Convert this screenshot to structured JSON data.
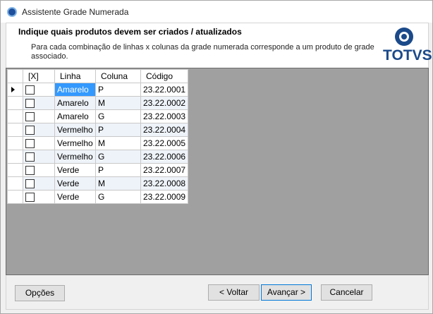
{
  "window": {
    "title": "Assistente Grade Numerada"
  },
  "header": {
    "title": "Indique quais produtos devem ser criados / atualizados",
    "description": "Para cada combinação de linhas x colunas da grade numerada corresponde a um produto de grade associado.",
    "logo_text": "TOTVS",
    "brand_color": "#1b4a8a"
  },
  "grid": {
    "columns": [
      "[X]",
      "Linha",
      "Coluna",
      "Código"
    ],
    "rows": [
      {
        "checked": false,
        "linha": "Amarelo",
        "coluna": "P",
        "codigo": "23.22.0001"
      },
      {
        "checked": false,
        "linha": "Amarelo",
        "coluna": "M",
        "codigo": "23.22.0002"
      },
      {
        "checked": false,
        "linha": "Amarelo",
        "coluna": "G",
        "codigo": "23.22.0003"
      },
      {
        "checked": false,
        "linha": "Vermelho",
        "coluna": "P",
        "codigo": "23.22.0004"
      },
      {
        "checked": false,
        "linha": "Vermelho",
        "coluna": "M",
        "codigo": "23.22.0005"
      },
      {
        "checked": false,
        "linha": "Vermelho",
        "coluna": "G",
        "codigo": "23.22.0006"
      },
      {
        "checked": false,
        "linha": "Verde",
        "coluna": "P",
        "codigo": "23.22.0007"
      },
      {
        "checked": false,
        "linha": "Verde",
        "coluna": "M",
        "codigo": "23.22.0008"
      },
      {
        "checked": false,
        "linha": "Verde",
        "coluna": "G",
        "codigo": "23.22.0009"
      }
    ],
    "selection_color": "#3399ff"
  },
  "buttons": {
    "options": "Opções",
    "back": "< Voltar",
    "next": "Avançar >",
    "cancel": "Cancelar"
  }
}
